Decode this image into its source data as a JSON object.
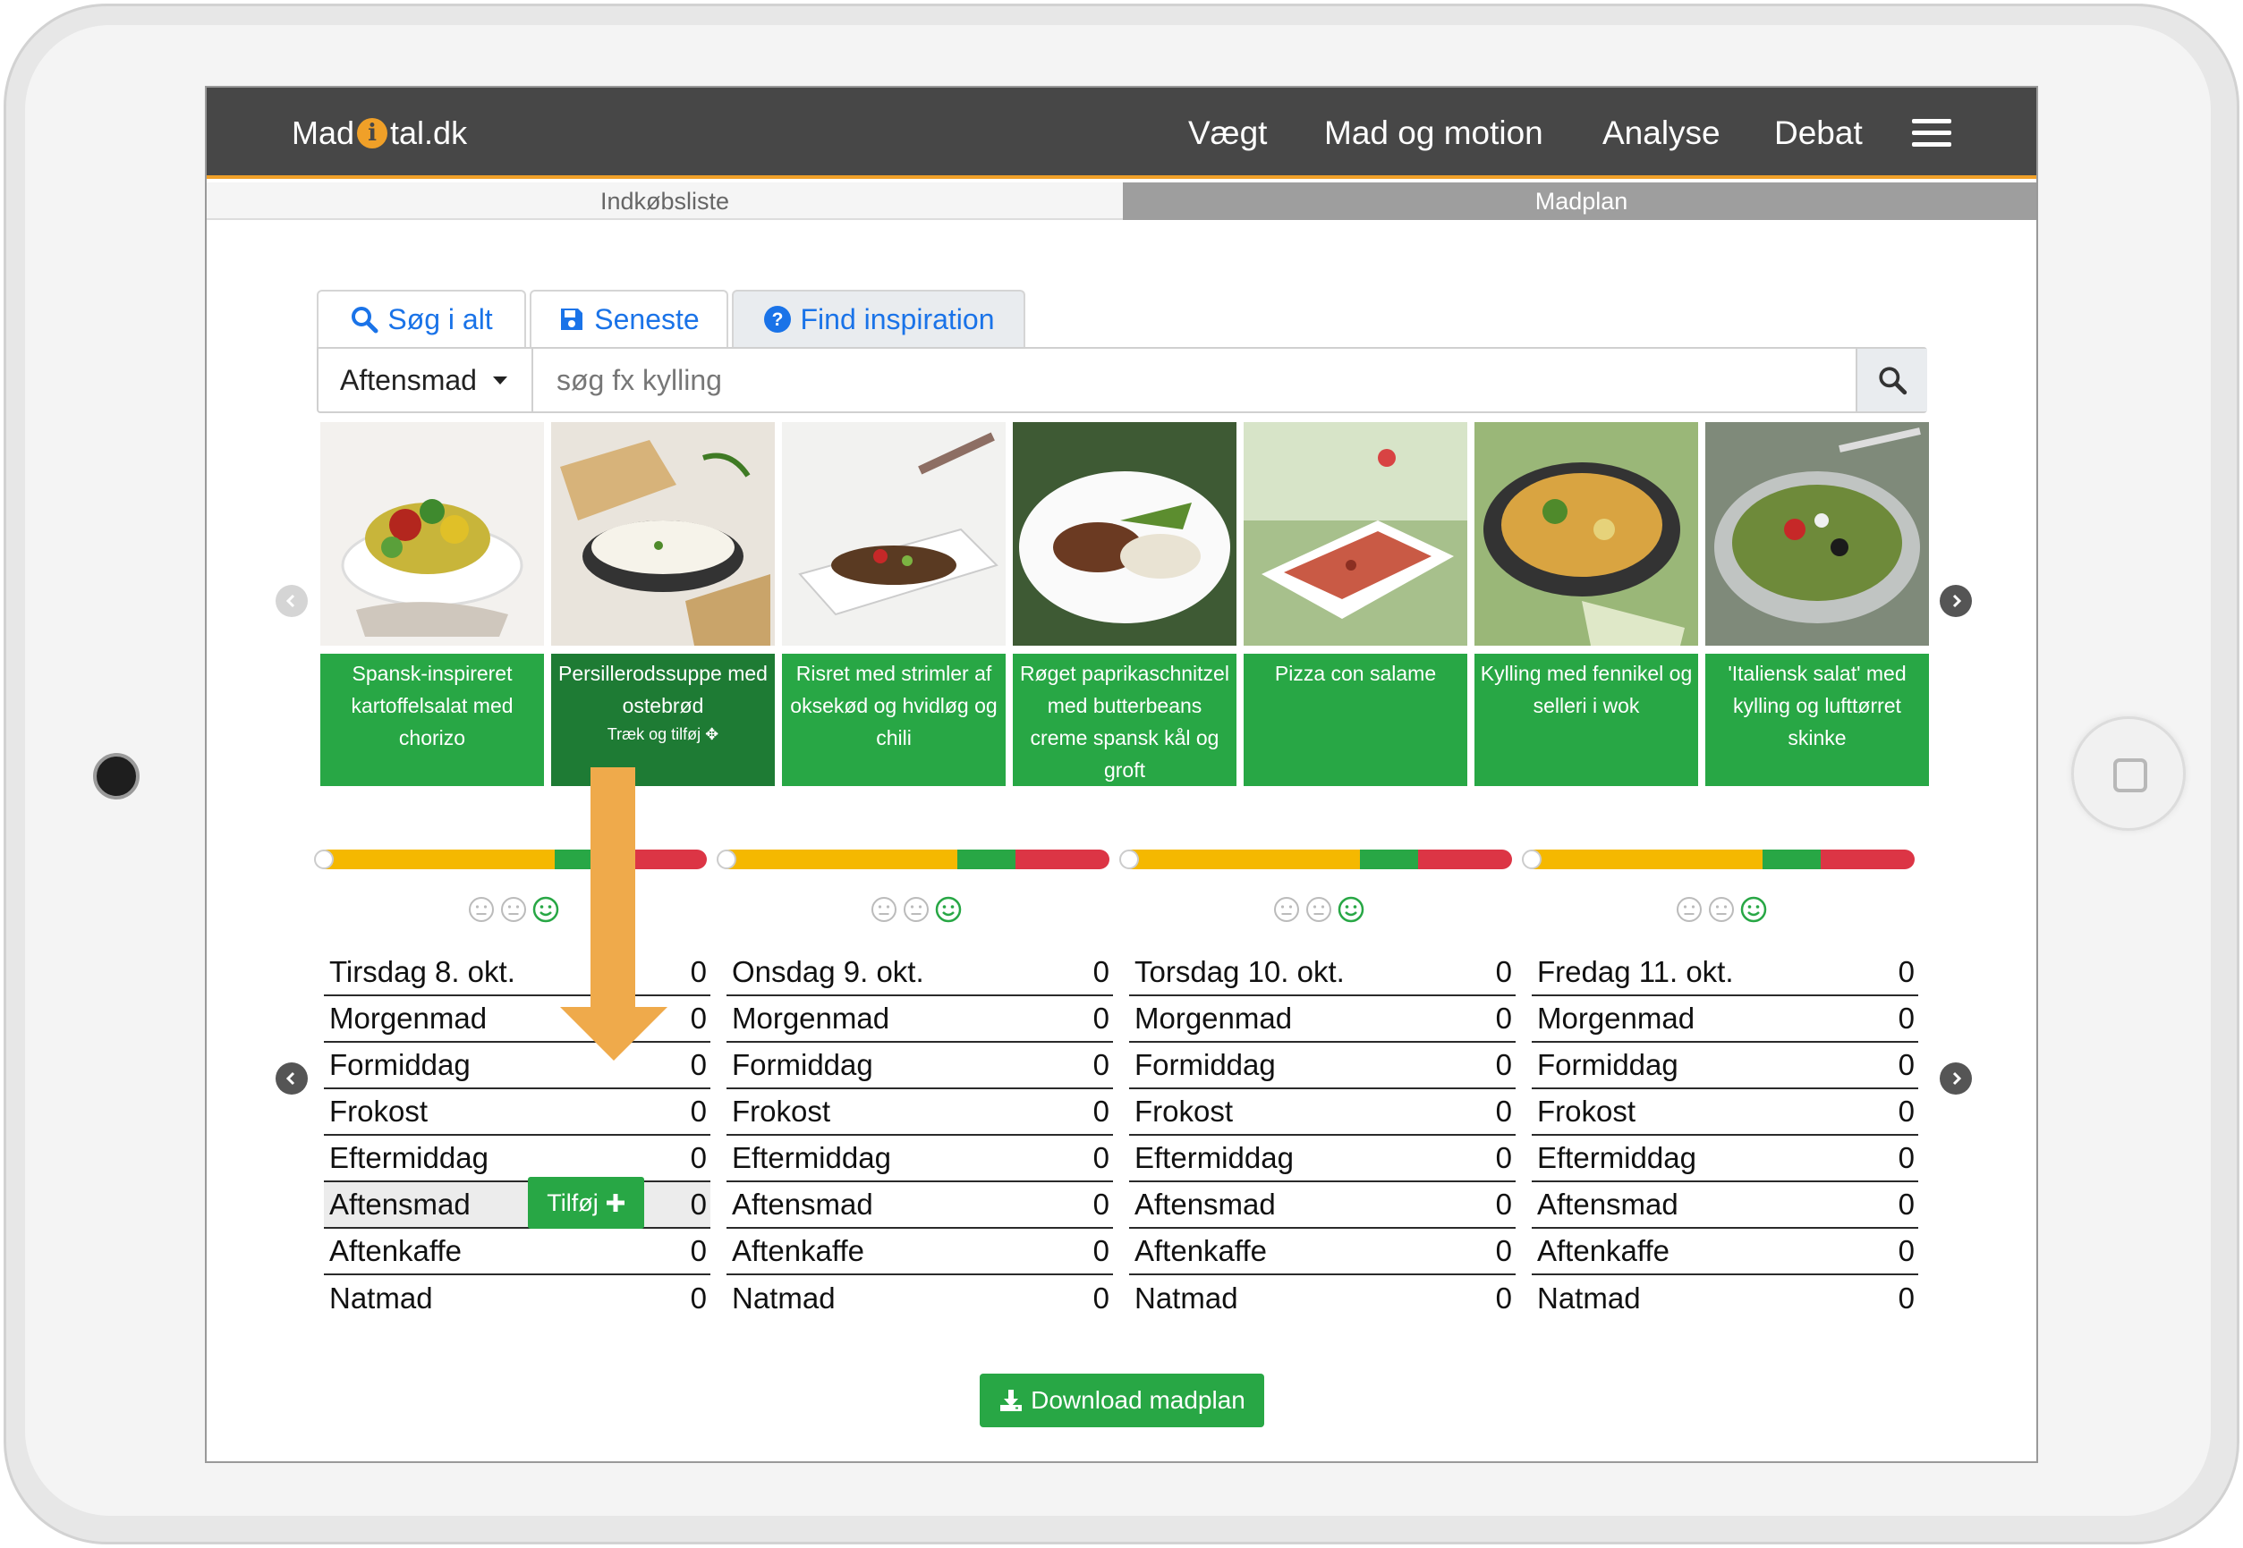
{
  "app": {
    "logo": {
      "left": "Mad",
      "icon": "i",
      "right": "tal.dk"
    },
    "nav": [
      "Vægt",
      "Mad og motion",
      "Analyse",
      "Debat"
    ],
    "menu_icon": "hamburger-icon",
    "accent_color": "#f0a028",
    "navbar_color": "#474747"
  },
  "subtabs": {
    "left": "Indkøbsliste",
    "right": "Madplan"
  },
  "search": {
    "tabs": [
      {
        "label": "Søg i alt",
        "icon": "search-icon"
      },
      {
        "label": "Seneste",
        "icon": "save-icon"
      },
      {
        "label": "Find inspiration",
        "icon": "question-circle-icon"
      }
    ],
    "meal_select": "Aftensmad",
    "placeholder": "søg fx kylling",
    "button_icon": "search-icon"
  },
  "recipes": [
    {
      "title": "Spansk-inspireret kartoffelsalat med chorizo"
    },
    {
      "title": "Persillerodssuppe med ostebrød",
      "hint": "Træk og tilføj ✥"
    },
    {
      "title": "Risret med strimler af oksekød og hvidløg og chili"
    },
    {
      "title": "Røget paprikaschnitzel med butterbeans creme spansk kål og groft"
    },
    {
      "title": "Pizza con salame"
    },
    {
      "title": "Kylling med fennikel og selleri i wok"
    },
    {
      "title": "'Italiensk salat' med kylling og lufttørret skinke"
    }
  ],
  "days": [
    {
      "name": "Tirsdag 8. okt.",
      "total": "0",
      "meals": [
        {
          "label": "Morgenmad",
          "value": "0"
        },
        {
          "label": "Formiddag",
          "value": "0"
        },
        {
          "label": "Frokost",
          "value": "0"
        },
        {
          "label": "Eftermiddag",
          "value": "0"
        },
        {
          "label": "Aftensmad",
          "value": "0"
        },
        {
          "label": "Aftenkaffe",
          "value": "0"
        },
        {
          "label": "Natmad",
          "value": "0"
        }
      ]
    },
    {
      "name": "Onsdag 9. okt.",
      "total": "0",
      "meals": [
        {
          "label": "Morgenmad",
          "value": "0"
        },
        {
          "label": "Formiddag",
          "value": "0"
        },
        {
          "label": "Frokost",
          "value": "0"
        },
        {
          "label": "Eftermiddag",
          "value": "0"
        },
        {
          "label": "Aftensmad",
          "value": "0"
        },
        {
          "label": "Aftenkaffe",
          "value": "0"
        },
        {
          "label": "Natmad",
          "value": "0"
        }
      ]
    },
    {
      "name": "Torsdag 10. okt.",
      "total": "0",
      "meals": [
        {
          "label": "Morgenmad",
          "value": "0"
        },
        {
          "label": "Formiddag",
          "value": "0"
        },
        {
          "label": "Frokost",
          "value": "0"
        },
        {
          "label": "Eftermiddag",
          "value": "0"
        },
        {
          "label": "Aftensmad",
          "value": "0"
        },
        {
          "label": "Aftenkaffe",
          "value": "0"
        },
        {
          "label": "Natmad",
          "value": "0"
        }
      ]
    },
    {
      "name": "Fredag 11. okt.",
      "total": "0",
      "meals": [
        {
          "label": "Morgenmad",
          "value": "0"
        },
        {
          "label": "Formiddag",
          "value": "0"
        },
        {
          "label": "Frokost",
          "value": "0"
        },
        {
          "label": "Eftermiddag",
          "value": "0"
        },
        {
          "label": "Aftensmad",
          "value": "0"
        },
        {
          "label": "Aftenkaffe",
          "value": "0"
        },
        {
          "label": "Natmad",
          "value": "0"
        }
      ]
    }
  ],
  "add_button": "Tilføj",
  "download_button": "Download madplan",
  "status_colors": {
    "yellow": "#f5b800",
    "green": "#28a745",
    "red": "#dc3545"
  }
}
